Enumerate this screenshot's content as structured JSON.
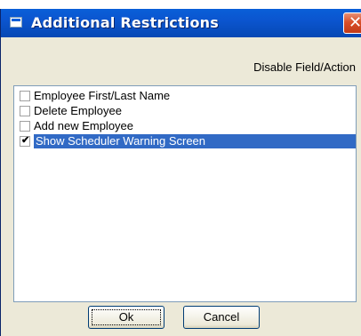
{
  "window": {
    "title": "Additional Restrictions",
    "close_symbol": "✕"
  },
  "header": {
    "column_label": "Disable Field/Action"
  },
  "list": {
    "items": [
      {
        "label": "Employee First/Last Name",
        "checked": false,
        "selected": false
      },
      {
        "label": "Delete Employee",
        "checked": false,
        "selected": false
      },
      {
        "label": "Add new Employee",
        "checked": false,
        "selected": false
      },
      {
        "label": "Show Scheduler Warning Screen",
        "checked": true,
        "selected": true
      }
    ]
  },
  "buttons": {
    "ok_label": "Ok",
    "cancel_label": "Cancel"
  },
  "colors": {
    "titlebar": "#0a5fd8",
    "selection": "#316ac5",
    "close": "#d94f2a",
    "dialog_bg": "#ece9d8"
  },
  "icons": {
    "title": "window-icon",
    "close": "close-icon",
    "check": "checkmark-icon"
  }
}
